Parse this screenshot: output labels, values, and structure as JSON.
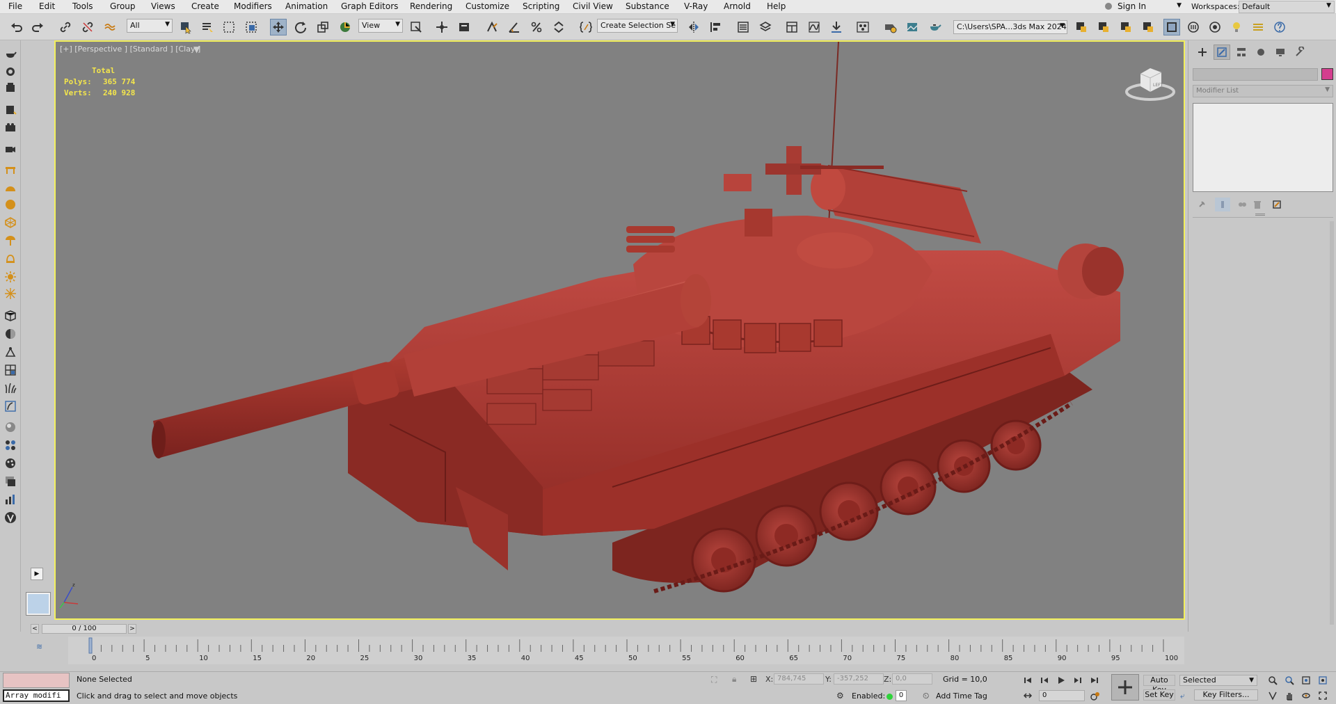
{
  "menu": [
    "File",
    "Edit",
    "Tools",
    "Group",
    "Views",
    "Create",
    "Modifiers",
    "Animation",
    "Graph Editors",
    "Rendering",
    "Customize",
    "Scripting",
    "Civil View",
    "Substance",
    "V-Ray",
    "Arnold",
    "Help"
  ],
  "account": {
    "sign_in": "Sign In",
    "workspaces_label": "Workspaces:",
    "workspace": "Default"
  },
  "toolbar": {
    "selection_filter": "All",
    "reference_coord": "View",
    "named_selection": "Create Selection Se",
    "project_path": "C:\\Users\\SPA...3ds Max 2024"
  },
  "viewport": {
    "label": "[+] [Perspective ] [Standard ] [Clay ]",
    "stats": {
      "total": "Total",
      "polys_label": "Polys:",
      "polys": "365 774",
      "verts_label": "Verts:",
      "verts": "240 928"
    },
    "viewcube_text": "LEFT",
    "model_color": "#b8433d"
  },
  "command_panel": {
    "modifier_list": "Modifier List",
    "object_color": "#d33e8e"
  },
  "time_slider": {
    "value": "0 / 100",
    "ticks": [
      "0",
      "5",
      "10",
      "15",
      "20",
      "25",
      "30",
      "35",
      "40",
      "45",
      "50",
      "55",
      "60",
      "65",
      "70",
      "75",
      "80",
      "85",
      "90",
      "95",
      "100"
    ]
  },
  "status": {
    "maxscript_listener": "Array modifi",
    "selection": "None Selected",
    "prompt": "Click and drag to select and move objects",
    "x_label": "X:",
    "x": "784,745",
    "y_label": "Y:",
    "y": "-357,252",
    "z_label": "Z:",
    "z": "0,0",
    "grid": "Grid = 10,0",
    "enabled_label": "Enabled:",
    "enabled_value": "0",
    "add_time_tag": "Add Time Tag",
    "current_frame": "0",
    "auto_key": "Auto Key",
    "set_key": "Set Key",
    "key_mode": "Selected",
    "key_filters": "Key Filters..."
  }
}
